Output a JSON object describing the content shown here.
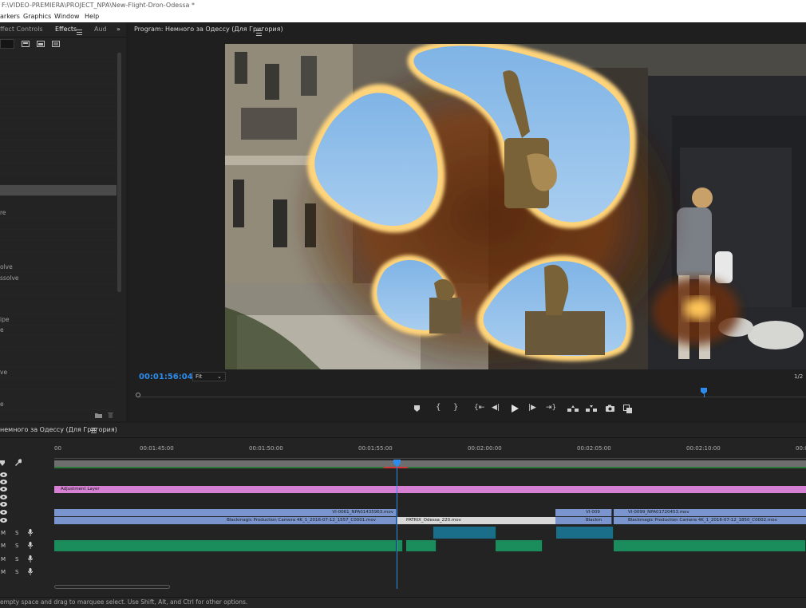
{
  "window": {
    "title": "F:\\VIDEO-PREMIERA\\PROJECT_NPA\\New-Flight-Dron-Odessa *"
  },
  "menu": {
    "items": [
      "arkers",
      "Graphics",
      "Window",
      "Help"
    ]
  },
  "left_panel": {
    "tabs": [
      "ffect Controls",
      "Effects",
      "Aud"
    ],
    "overflow_icon": "double-chevron-right",
    "visible_items": [
      "re",
      "olve",
      "ssolve",
      "ipe",
      "e",
      "ve",
      "e"
    ]
  },
  "program": {
    "title": "Program: Немного за Одессу (Для Григория)",
    "timecode": "00:01:56:04",
    "fit_label": "Fit",
    "page": "1/2"
  },
  "timeline": {
    "sequence_tab": "немного за Одессу (Для Григория)",
    "ruler_labels": [
      "00",
      "00:01:45:00",
      "00:01:50:00",
      "00:01:55:00",
      "00:02:00:00",
      "00:02:05:00",
      "00:02:10:00",
      "00:0"
    ],
    "track_buttons": [
      "M",
      "S"
    ],
    "clips": {
      "adjustment": "Adjustment Layer",
      "v2_a": "VI-0061_NPA01435963.mov",
      "v2_b": "VI-009",
      "v2_c": "VI-0099_NPA01720453.mov",
      "v1_a": "Blackmagic Production Camera 4K_1_2016-07-12_1557_C0001.mov",
      "v1_b": "PATRIX_Odessa_220.mov",
      "v1_c": "Blackm",
      "v1_d": "Blackmagic Production Camera 4K_1_2016-07-12_1850_C0002.mov"
    }
  },
  "status_bar": {
    "text": "empty space and drag to marquee select. Use Shift, Alt, and Ctrl for other options."
  },
  "colors": {
    "accent_blue": "#2d8ceb",
    "adjustment_clip": "#d580d3",
    "video_clip": "#7a95cd",
    "audio_clip": "#1b8c5c"
  }
}
